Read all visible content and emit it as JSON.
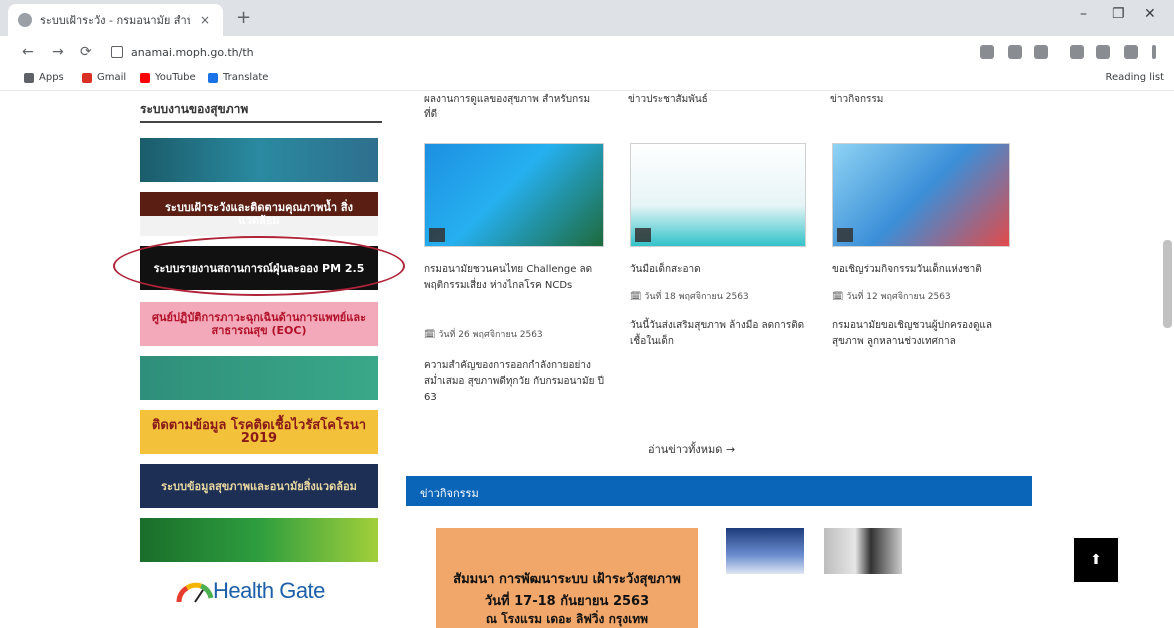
{
  "browser": {
    "tab_title": "ระบบเฝ้าระวัง - กรมอนามัย สำนักงาน",
    "tab_close": "×",
    "new_tab": "+",
    "window_controls": [
      "–",
      "❐",
      "✕"
    ],
    "url": "anamai.moph.go.th/th",
    "nav": {
      "back": "←",
      "forward": "→",
      "reload": "⟳"
    },
    "bookmarks": [
      {
        "label": "Apps",
        "color": "#5f6368"
      },
      {
        "label": "Gmail",
        "color": "#d93025"
      },
      {
        "label": "YouTube",
        "color": "#ff0000"
      },
      {
        "label": "Translate",
        "color": "#1a73e8"
      }
    ],
    "reading_list": "Reading list"
  },
  "sidebar": {
    "title": "ระบบงานของสุขภาพ",
    "banners": [
      {
        "text": "",
        "bg": "linear-gradient(90deg,#1b5c6b,#2a8aa0,#2e6f8e)"
      },
      {
        "text": "ระบบเฝ้าระวังและติดตามคุณภาพน้ำ สิ่งแวดล้อม",
        "bg": "linear-gradient(180deg,#5a1e12 0%,#5a1e12 55%,#f2f2f2 55%)"
      },
      {
        "text": "ระบบรายงานสถานการณ์ฝุ่นละออง PM 2.5",
        "bg": "#111111"
      },
      {
        "text": "ศูนย์ปฏิบัติการภาวะฉุกเฉินด้านการแพทย์และสาธารณสุข (EOC)",
        "bg": "#f3a9b9"
      },
      {
        "text": "",
        "bg": "linear-gradient(90deg,#2f8f7a,#3aa889)"
      },
      {
        "text": "ติดตามข้อมูล โรคติดเชื้อไวรัสโคโรนา 2019",
        "bg": "#f3c23a"
      },
      {
        "text": "ระบบข้อมูลสุขภาพและอนามัยสิ่งแวดล้อม",
        "bg": "#1e2f55"
      },
      {
        "text": "",
        "bg": "linear-gradient(90deg,#1a6e2a,#2e9e3f,#a2cf3a)"
      }
    ],
    "logo_text": "Health Gate"
  },
  "news": {
    "columns": [
      {
        "heading": "ผลงานการดูแลของสุขภาพ สำหรับกรม ที่ดี",
        "title": "กรมอนามัยชวนคนไทย Challenge ลด พฤติกรรมเสี่ยง ห่างไกลโรค NCDs",
        "meta": "🗓 วันที่ 26 พฤศจิกายน 2563",
        "excerpt": "ความสำคัญของการออกกำลังกายอย่างสม่ำเสมอ สุขภาพดีทุกวัย กับกรมอนามัย ปี 63",
        "thumb_bg": "linear-gradient(135deg,#1d8fe1 0%,#26b0f0 45%,#1e6a3c 100%)"
      },
      {
        "heading": "ข่าวประชาสัมพันธ์",
        "title": "วันมือเด็กสะอาด",
        "meta": "🗓 วันที่ 18 พฤศจิกายน 2563",
        "excerpt": "วันนี้วันส่งเสริมสุขภาพ ล้างมือ ลดการติดเชื้อในเด็ก",
        "thumb_bg": "linear-gradient(180deg,#ffffff 0%,#e6f4f6 60%,#32c3c9 100%)"
      },
      {
        "heading": "ข่าวกิจกรรม",
        "title": "ขอเชิญร่วมกิจกรรมวันเด็กแห่งชาติ",
        "meta": "🗓 วันที่ 12 พฤศจิกายน 2563",
        "excerpt": "กรมอนามัยขอเชิญชวนผู้ปกครองดูแลสุขภาพ ลูกหลานช่วงเทศกาล",
        "thumb_bg": "linear-gradient(135deg,#8fd3f4 0%,#3b8fd8 50%,#e14a4a 100%)"
      }
    ],
    "read_more": "อ่านข่าวทั้งหมด →"
  },
  "section_bar": {
    "title": "ข่าวกิจกรรม"
  },
  "photos": {
    "main_caption_1": "สัมมนา การพัฒนาระบบ เฝ้าระวังสุขภาพ",
    "main_caption_2": "วันที่ 17-18 กันยายน 2563",
    "main_caption_3": "ณ โรงแรม เดอะ ลิฟวิ่ง กรุงเทพ"
  },
  "scroll_top_label": "⬆"
}
